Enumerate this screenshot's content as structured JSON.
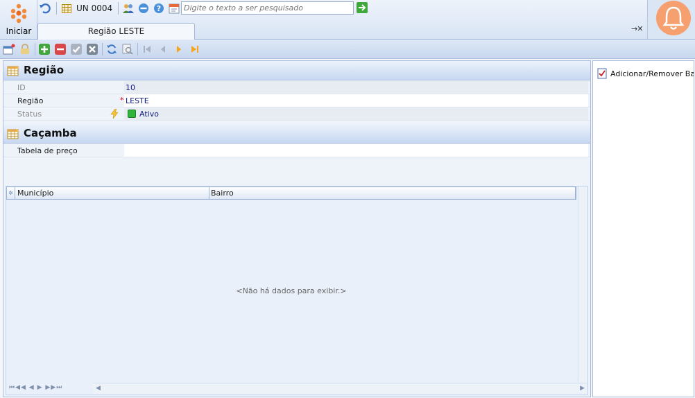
{
  "start": {
    "label": "Iniciar"
  },
  "quickaccess": {
    "unit_label": "UN 0004"
  },
  "search": {
    "placeholder": "Digite o texto a ser pesquisado"
  },
  "tab": {
    "label": "Região LESTE",
    "close_glyph": "→✕"
  },
  "sections": {
    "regiao": {
      "title": "Região",
      "fields": {
        "id": {
          "label": "ID",
          "value": "10"
        },
        "regiao": {
          "label": "Região",
          "value": "LESTE",
          "required_mark": "*"
        },
        "status": {
          "label": "Status",
          "value": "Ativo"
        }
      }
    },
    "cacamba": {
      "title": "Caçamba",
      "fields": {
        "tabela": {
          "label": "Tabela de preço",
          "value": ""
        }
      }
    }
  },
  "grid": {
    "columns": [
      "Município",
      "Bairro"
    ],
    "empty_message": "<Não há dados para exibir.>",
    "pager_glyphs": "⏮◀◀ ◀ ▶ ▶▶⏭"
  },
  "side": {
    "action_label": "Adicionar/Remover Ba..."
  },
  "colors": {
    "accent_orange": "#f5a06e",
    "header_blue": "#c7d8f1",
    "status_green": "#2fb53a"
  }
}
